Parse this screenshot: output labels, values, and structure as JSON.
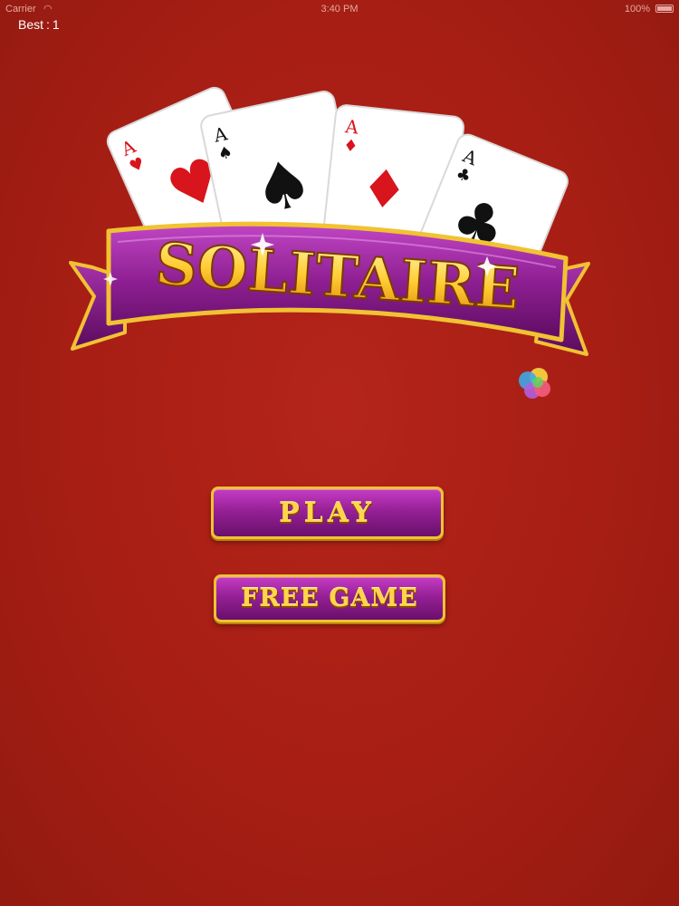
{
  "status_bar": {
    "carrier": "Carrier",
    "wifi_icon": "wifi-icon",
    "time": "3:40 PM",
    "battery": "100%"
  },
  "best": {
    "label": "Best",
    "separator": ":",
    "value": "1"
  },
  "logo": {
    "title": "SOLITAIRE",
    "cards": [
      {
        "rank": "A",
        "suit": "hearts",
        "symbol": "♥",
        "color": "#d8141c"
      },
      {
        "rank": "A",
        "suit": "spades",
        "symbol": "♠",
        "color": "#111111"
      },
      {
        "rank": "A",
        "suit": "diamonds",
        "symbol": "♦",
        "color": "#d8141c"
      },
      {
        "rank": "A",
        "suit": "clubs",
        "symbol": "♣",
        "color": "#111111"
      }
    ]
  },
  "buttons": {
    "play": "PLAY",
    "free_game": "FREE GAME"
  },
  "game_center_icon": "game-center-icon",
  "colors": {
    "felt": "#a71e14",
    "ribbon_purple": "#8e1f92",
    "gold": "#f1c232",
    "title_text": "#ffd54a"
  }
}
